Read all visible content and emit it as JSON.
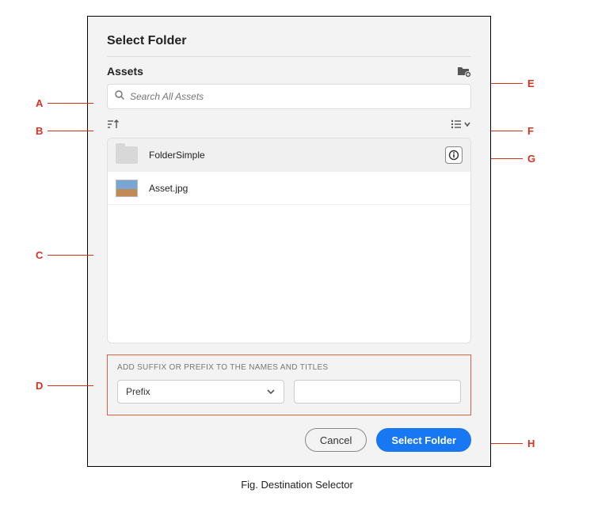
{
  "dialog": {
    "title": "Select Folder",
    "assets_label": "Assets"
  },
  "search": {
    "placeholder": "Search All Assets",
    "value": ""
  },
  "list": {
    "items": [
      {
        "type": "folder",
        "label": "FolderSimple",
        "selected": true,
        "has_info": true
      },
      {
        "type": "image",
        "label": "Asset.jpg",
        "selected": false,
        "has_info": false
      }
    ]
  },
  "suffix": {
    "title": "ADD SUFFIX OR PREFIX TO THE NAMES AND TITLES",
    "select_value": "Prefix",
    "input_value": ""
  },
  "footer": {
    "cancel": "Cancel",
    "select": "Select Folder"
  },
  "caption": "Fig. Destination Selector",
  "callouts": {
    "A": "A",
    "B": "B",
    "C": "C",
    "D": "D",
    "E": "E",
    "F": "F",
    "G": "G",
    "H": "H"
  }
}
